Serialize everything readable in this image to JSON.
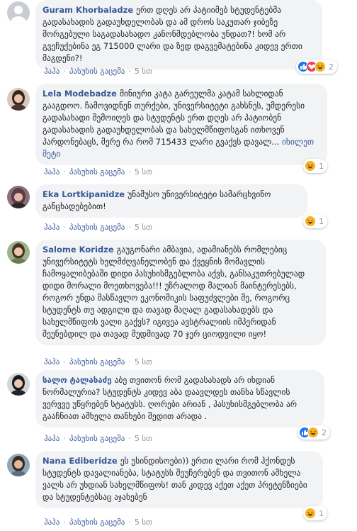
{
  "comments": [
    {
      "author": "Guram Khorbaladze",
      "text": "ერთ დღეს არ პატიიმებ სტუდენტებმა გადასახადის გადაუხდელობას და ამ დროს საკუთარ ჯიბეზე მორგებული საგადასახადო კანონმდებლობა უნდათ?! ხომ არ გვეჩუქებინა ეგ 715000 ლარი და ზედ დაგვემატებინა კიდევ ერთი მაგდენი?!",
      "like": "ჰაჰა",
      "reply": "პასუხის გაცემა",
      "time": "5 სთ",
      "reactions": [
        "like-icon",
        "love-icon",
        "haha-icon"
      ],
      "reaction_count": "2"
    },
    {
      "author": "Lela Modebadze",
      "text": "მინიური კატა გარეულმა კატამ სახლიდან გააგდოო. ჩამოვიდნენ თურქები, უნივერსიტეტი გახსნეს, უმდერესი გადასახადი შემოიღეს და სტუდენტს ერთ დღეს არ პატიობენ გადასახადის გადაუხდელობას და სახელმწიფოსგან ითხოვენ პარდონებაცს, მერე რა რომ 715433 ლარი გვაქვს დავალ...",
      "see_more": "იხილეთ მეტი",
      "like": "ჰაჰა",
      "reply": "პასუხის გაცემა",
      "time": "5 სთ",
      "reactions": [
        "haha-icon"
      ],
      "reaction_count": "1"
    },
    {
      "author": "Eka Lortkipanidze",
      "text": "უნამუსო უნივერსიტეტი სამარცხვინო განცხადებებით!",
      "like": "ჰაჰა",
      "reply": "პასუხის გაცემა",
      "time": "5 სთ",
      "reactions": [
        "haha-icon"
      ],
      "reaction_count": "1"
    },
    {
      "author": "Salome Koridze",
      "text": "გაუგონარი ამბავია, ადამიანებს რომლებიც უნივერსიტეტს ხელმძღვანელობენ და ქვეყნის მომავლის ჩამოყალიბებაში დიდი პასუხისმგებლობა აქვს, განსაკუთრებულად დიდი მორალი მოეთხოვება!!! უზრალოდ მალიან მაინტერესებს, როგორ უნდა მასწავლო ეკონომიკის საფუძვლები მე, როგორც სტუდენტს თუ ადგილი და თავად მაღალ გადასახადებს და სახელმწიფოს ვალი გაქვს? იგივეა ავსტრალიის იმპერიდან შეუნებდილ და თავად მუდმივად 70 ჯერ ციოდვილი იყო!",
      "like": "ჰაჰა",
      "reply": "პასუხის გაცემა",
      "time": "5 სთ",
      "reactions": [],
      "reaction_count": ""
    },
    {
      "author": "სალო ტალახაძე",
      "text": "აბე თვითონ რომ გადასახადს არ იხდიან ნორმალურია? სტუდენტს კიდევ აბა დაავლდეს თანხა სწავლის ვერვვე უწყრებენ სტატუსს. ღორები არიან , პასუხისმგებლობა არ გააჩნიათ ამხელა თანხები შედით არადა .",
      "like": "ჰაჰა",
      "reply": "პასუხის გაცემა",
      "time": "5 სთ",
      "reactions": [
        "like-icon",
        "haha-icon"
      ],
      "reaction_count": "2"
    },
    {
      "author": "Nana Ediberidze",
      "text": "ეს უსინდისოები)) ერთი ლარი რომ ჰქონდეს სტუდენტს დავალიანება, სტატუსს შეუჩერებენ და თვითონ ამხელა ვალს არ უხდიან სახელმწიფოს! თან კიდევ აქეთ აქეთ პრეტენზიები და სტუდენტებსაც აჯახებენ",
      "like": "ჰაჰა",
      "reply": "პასუხის გაცემა",
      "time": "5 სთ",
      "reactions": [
        "haha-icon"
      ],
      "reaction_count": "1"
    }
  ],
  "colors": {
    "author": "#385898",
    "bubble": "#f2f3f5",
    "meta": "#90949c",
    "like_icon": "#1877f2",
    "love_icon": "#f33e58",
    "haha_icon": "#f7b125"
  }
}
